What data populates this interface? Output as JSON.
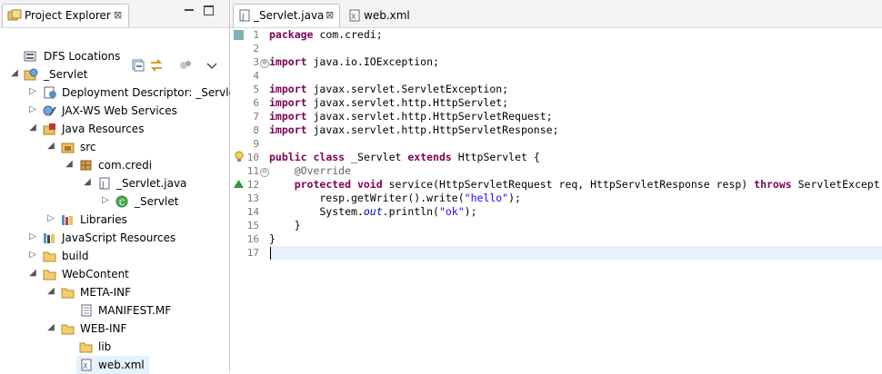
{
  "project_explorer": {
    "tab_label": "Project Explorer",
    "close_glyph": "⊠",
    "tree": [
      {
        "label": "DFS Locations",
        "icon": "dfs-icon",
        "arrow": ""
      },
      {
        "label": "_Servlet",
        "icon": "web-project-icon",
        "arrow": "◢"
      },
      {
        "label": "Deployment Descriptor: _Servle",
        "icon": "deployment-descriptor-icon",
        "arrow": "▷"
      },
      {
        "label": "JAX-WS Web Services",
        "icon": "web-services-icon",
        "arrow": "▷"
      },
      {
        "label": "Java Resources",
        "icon": "java-resources-icon",
        "arrow": "◢"
      },
      {
        "label": "src",
        "icon": "source-folder-icon",
        "arrow": "◢"
      },
      {
        "label": "com.credi",
        "icon": "package-icon",
        "arrow": "◢"
      },
      {
        "label": "_Servlet.java",
        "icon": "java-file-icon",
        "arrow": "◢"
      },
      {
        "label": "_Servlet",
        "icon": "class-icon",
        "arrow": "▷"
      },
      {
        "label": "Libraries",
        "icon": "libraries-icon",
        "arrow": "▷"
      },
      {
        "label": "JavaScript Resources",
        "icon": "javascript-resources-icon",
        "arrow": "▷"
      },
      {
        "label": "build",
        "icon": "folder-icon",
        "arrow": "▷"
      },
      {
        "label": "WebContent",
        "icon": "folder-icon",
        "arrow": "◢"
      },
      {
        "label": "META-INF",
        "icon": "folder-icon",
        "arrow": "◢"
      },
      {
        "label": "MANIFEST.MF",
        "icon": "text-file-icon",
        "arrow": ""
      },
      {
        "label": "WEB-INF",
        "icon": "folder-icon",
        "arrow": "◢"
      },
      {
        "label": "lib",
        "icon": "folder-icon",
        "arrow": ""
      },
      {
        "label": "web.xml",
        "icon": "xml-file-icon",
        "arrow": ""
      }
    ]
  },
  "editor": {
    "tabs": [
      {
        "label": "_Servlet.java",
        "active": true,
        "icon": "java-file-icon"
      },
      {
        "label": "web.xml",
        "active": false,
        "icon": "xml-file-icon"
      }
    ],
    "close_glyph": "⊠",
    "line_numbers": [
      "1",
      "2",
      "3",
      "4",
      "5",
      "6",
      "7",
      "8",
      "9",
      "10",
      "11",
      "12",
      "13",
      "14",
      "15",
      "16",
      "17"
    ],
    "code_lines": [
      "package com.credi;",
      "",
      "import java.io.IOException;",
      "",
      "import javax.servlet.ServletException;",
      "import javax.servlet.http.HttpServlet;",
      "import javax.servlet.http.HttpServletRequest;",
      "import javax.servlet.http.HttpServletResponse;",
      "",
      "public class _Servlet extends HttpServlet {",
      "    @Override",
      "    protected void service(HttpServletRequest req, HttpServletResponse resp) throws ServletExcept",
      "        resp.getWriter().write(\"hello\");",
      "        System.out.println(\"ok\");",
      "    }",
      "}",
      ""
    ]
  },
  "colors": {
    "keyword": "#7f0055",
    "string": "#2a00ff",
    "annotation": "#646464",
    "selection": "#e5f1fb",
    "current_line": "#e8f2fe"
  }
}
